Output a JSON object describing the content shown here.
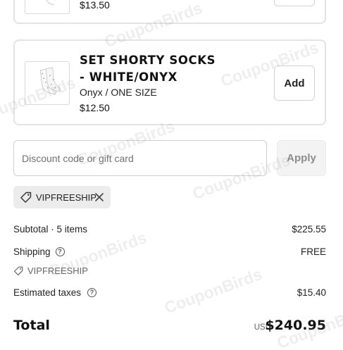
{
  "items": [
    {
      "price": "$13.50",
      "add_label": ""
    },
    {
      "title": "SET SHORTY SOCKS - WHITE/ONYX",
      "variant": "Onyx / ONE SIZE",
      "price": "$12.50",
      "add_label": "Add"
    }
  ],
  "discount": {
    "placeholder": "Discount code or gift card",
    "apply_label": "Apply"
  },
  "applied_code": {
    "code": "VIPFREESHIP",
    "icon": "tag-icon"
  },
  "summary": {
    "subtotal_label": "Subtotal · 5 items",
    "subtotal_value": "$225.55",
    "shipping_label": "Shipping",
    "shipping_value": "FREE",
    "shipping_code": "VIPFREESHIP",
    "taxes_label": "Estimated taxes",
    "taxes_value": "$15.40",
    "total_label": "Total",
    "currency": "USD",
    "total_value": "$240.95"
  },
  "watermark": "CouponBirds",
  "colors": {
    "border": "#e3e3e3",
    "chip_bg": "#ececec",
    "apply_bg": "#f3f3f3",
    "muted_text": "#707070"
  }
}
